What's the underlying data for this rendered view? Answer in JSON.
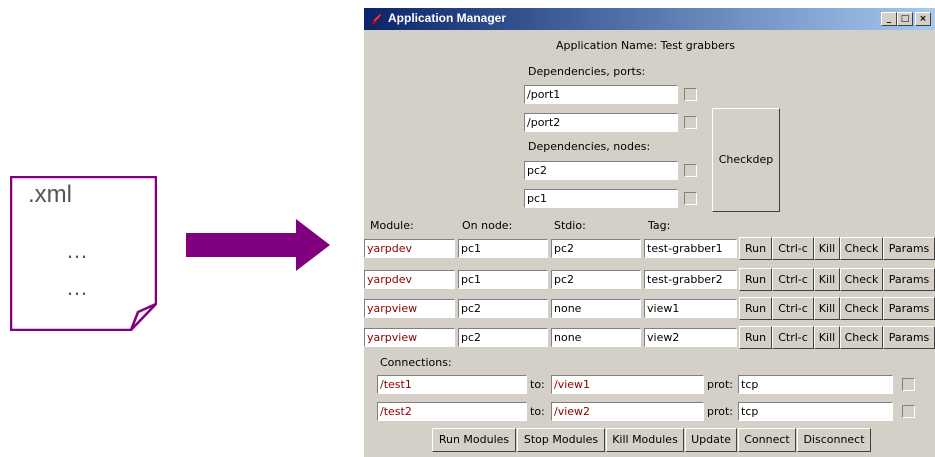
{
  "illustration": {
    "file_label": ".xml",
    "dots_line_1": "…",
    "dots_line_2": "…",
    "accent_color": "#800080"
  },
  "window": {
    "title": "Application Manager",
    "app_icon": "tk-feather-icon",
    "minimize": "_",
    "maximize": "□",
    "close": "×"
  },
  "application_name_label": "Application Name: Test grabbers",
  "dependencies_ports_label": "Dependencies, ports:",
  "ports": [
    {
      "value": "/port1"
    },
    {
      "value": "/port2"
    }
  ],
  "dependencies_nodes_label": "Dependencies, nodes:",
  "nodes": [
    {
      "value": "pc2"
    },
    {
      "value": "pc1"
    }
  ],
  "checkdep_button": "Checkdep",
  "module_headers": {
    "module": "Module:",
    "on_node": "On node:",
    "stdio": "Stdio:",
    "tag": "Tag:"
  },
  "module_buttons": {
    "run": "Run",
    "ctrlc": "Ctrl-c",
    "kill": "Kill",
    "check": "Check",
    "params": "Params"
  },
  "modules": [
    {
      "module": "yarpdev",
      "node": "pc1",
      "stdio": "pc2",
      "tag": "test-grabber1"
    },
    {
      "module": "yarpdev",
      "node": "pc1",
      "stdio": "pc2",
      "tag": "test-grabber2"
    },
    {
      "module": "yarpview",
      "node": "pc2",
      "stdio": "none",
      "tag": "view1"
    },
    {
      "module": "yarpview",
      "node": "pc2",
      "stdio": "none",
      "tag": "view2"
    }
  ],
  "connections_label": "Connections:",
  "connection_labels": {
    "to": "to:",
    "prot": "prot:"
  },
  "connections": [
    {
      "from": "/test1",
      "to": "/view1",
      "prot": "tcp"
    },
    {
      "from": "/test2",
      "to": "/view2",
      "prot": "tcp"
    }
  ],
  "bottom_buttons": {
    "run_modules": "Run Modules",
    "stop_modules": "Stop Modules",
    "kill_modules": "Kill Modules",
    "update": "Update",
    "connect": "Connect",
    "disconnect": "Disconnect"
  }
}
